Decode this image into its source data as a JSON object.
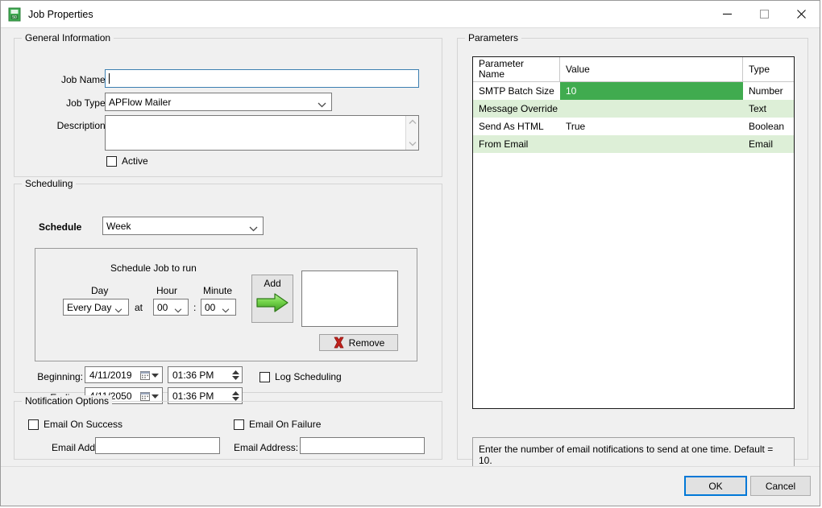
{
  "window": {
    "title": "Job Properties",
    "icon": "job-properties-icon",
    "controls": {
      "minimize": "minimize-icon",
      "maximize": "maximize-icon",
      "close": "close-icon"
    }
  },
  "general": {
    "legend": "General Information",
    "job_name_label": "Job Name:",
    "job_name_value": "",
    "job_type_label": "Job Type:",
    "job_type_value": "APFlow Mailer",
    "description_label": "Description:",
    "description_value": "",
    "active_label": "Active",
    "active_checked": false
  },
  "scheduling": {
    "legend": "Scheduling",
    "schedule_label": "Schedule",
    "schedule_value": "Week",
    "run_panel_title": "Schedule Job to run",
    "day_label": "Day",
    "day_value": "Every Day",
    "at_label": "at",
    "hour_label": "Hour",
    "hour_value": "00",
    "colon": ":",
    "minute_label": "Minute",
    "minute_value": "00",
    "add_label": "Add",
    "add_icon": "green-arrow-right-icon",
    "remove_label": "Remove",
    "remove_icon": "red-x-icon",
    "schedule_list_items": [],
    "beginning_label": "Beginning:",
    "beginning_date": "4/11/2019",
    "beginning_time": "01:36 PM",
    "ending_label": "Ending:",
    "ending_date": "4/11/2050",
    "ending_time": "01:36 PM",
    "log_scheduling_label": "Log Scheduling",
    "log_scheduling_checked": false
  },
  "notification": {
    "legend": "Notification Options",
    "email_success_label": "Email On Success",
    "email_success_checked": false,
    "email_success_addr_label": "Email Address:",
    "email_success_addr_value": "",
    "email_failure_label": "Email On Failure",
    "email_failure_checked": false,
    "email_failure_addr_label": "Email Address:",
    "email_failure_addr_value": ""
  },
  "parameters": {
    "legend": "Parameters",
    "columns": [
      "Parameter\nName",
      "Value",
      "Type"
    ],
    "col_name_header": "Parameter Name",
    "col_value_header": "Value",
    "col_type_header": "Type",
    "rows": [
      {
        "name": "SMTP Batch Size",
        "value": "10",
        "type": "Number",
        "selected": true
      },
      {
        "name": "Message Override",
        "value": "",
        "type": "Text",
        "selected": false
      },
      {
        "name": "Send As HTML",
        "value": "True",
        "type": "Boolean",
        "selected": false
      },
      {
        "name": "From Email",
        "value": "",
        "type": "Email",
        "selected": false
      }
    ],
    "hint": "Enter the number of email notifications to send at one time. Default = 10."
  },
  "footer": {
    "ok_label": "OK",
    "cancel_label": "Cancel"
  },
  "colors": {
    "selected_row": "#40ab4f",
    "alt_row": "#ddefd7",
    "accent": "#0078d7",
    "dialog_bg": "#f0f0f0"
  }
}
